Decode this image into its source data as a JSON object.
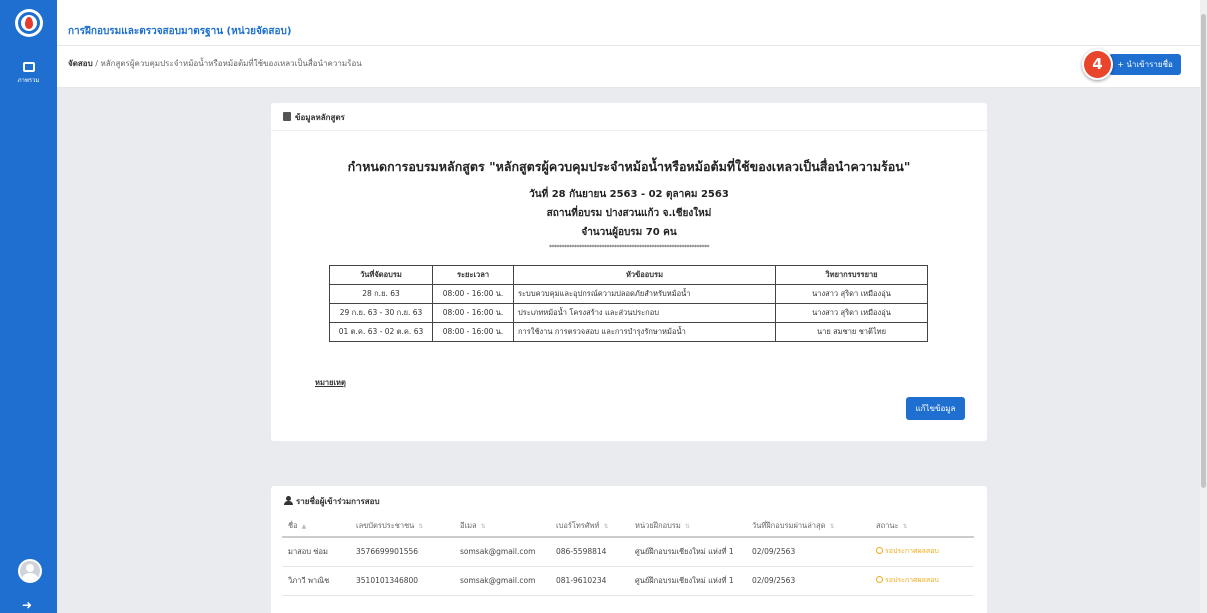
{
  "sidebar": {
    "item_label": "ภาพรวม"
  },
  "header": {
    "title": "การฝึกอบรมและตรวจสอบมาตรฐาน (หน่วยจัดสอบ)"
  },
  "breadcrumb": {
    "root": "จัดสอบ",
    "separator": " / ",
    "current": "หลักสูตรผู้ควบคุมประจำหม้อน้ำหรือหม้อต้มที่ใช้ของเหลวเป็นสื่อนำความร้อน"
  },
  "actions": {
    "import_label": "+ นำเข้ารายชื่อ",
    "step_number": "4"
  },
  "course": {
    "card_title": "ข้อมูลหลักสูตร",
    "title": "กำหนดการอบรมหลักสูตร \"หลักสูตรผู้ควบคุมประจำหม้อน้ำหรือหม้อต้มที่ใช้ของเหลวเป็นสื่อนำความร้อน\"",
    "dates": "วันที่ 28 กันยายน 2563 - 02 ตุลาคม 2563",
    "venue": "สถานที่อบรม ปางสวนแก้ว จ.เชียงใหม่",
    "participants": "จำนวนผู้อบรม 70 คน",
    "separator": "****************************************************************",
    "columns": [
      "วันที่จัดอบรม",
      "ระยะเวลา",
      "หัวข้ออบรม",
      "วิทยากรบรรยาย"
    ],
    "rows": [
      [
        "28 ก.ย. 63",
        "08:00 - 16:00 น.",
        "ระบบควบคุมและอุปกรณ์ความปลอดภัยสำหรับหม้อน้ำ",
        "นางสาว สุริดา เหมืองอุ่น"
      ],
      [
        "29 ก.ย. 63 - 30 ก.ย. 63",
        "08:00 - 16:00 น.",
        "ประเภทหม้อน้ำ โครงสร้าง และส่วนประกอบ",
        "นางสาว สุริดา เหมืองอุ่น"
      ],
      [
        "01 ต.ค. 63 - 02 ต.ค. 63",
        "08:00 - 16:00 น.",
        "การใช้งาน การตรวจสอบ และการบำรุงรักษาหม้อน้ำ",
        "นาย สมชาย ชาติไทย"
      ]
    ],
    "remark_label": "หมายเหตุ",
    "edit_label": "แก้ไขข้อมูล"
  },
  "participants": {
    "card_title": "รายชื่อผู้เข้าร่วมการสอบ",
    "columns": [
      "ชื่อ",
      "เลขบัตรประชาชน",
      "อีเมล",
      "เบอร์โทรศัพท์",
      "หน่วยฝึกอบรม",
      "วันที่ฝึกอบรมผ่านล่าสุด",
      "สถานะ"
    ],
    "rows": [
      {
        "name": "มาสอบ ซ่อม",
        "id": "3576699901556",
        "email": "somsak@gmail.com",
        "phone": "086-5598814",
        "unit": "ศูนย์ฝึกอบรมเชียงใหม่ แห่งที่ 1",
        "date": "02/09/2563",
        "status": "รอประกาศผลสอบ"
      },
      {
        "name": "วิภาวี พาณิช",
        "id": "3510101346800",
        "email": "somsak@gmail.com",
        "phone": "081-9610234",
        "unit": "ศูนย์ฝึกอบรมเชียงใหม่ แห่งที่ 1",
        "date": "02/09/2563",
        "status": "รอประกาศผลสอบ"
      }
    ]
  }
}
